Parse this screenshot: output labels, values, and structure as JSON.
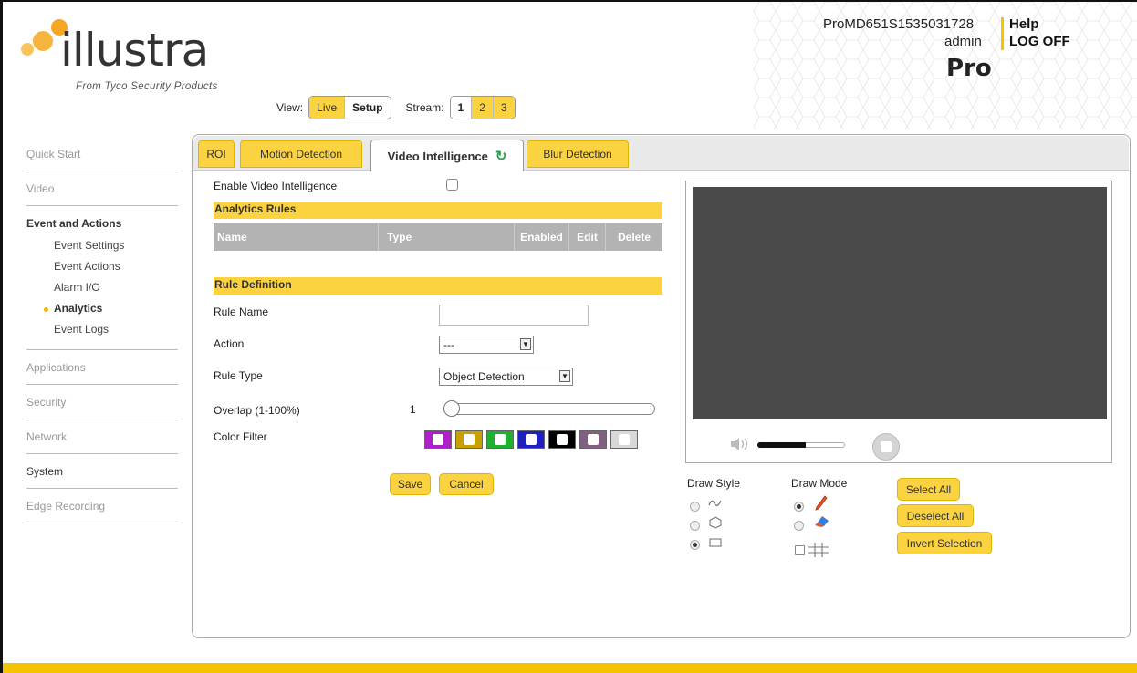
{
  "header": {
    "logo_text": "illustra",
    "logo_tagline": "From Tyco Security Products",
    "device_id": "ProMD651S1535031728",
    "user": "admin",
    "help": "Help",
    "logoff": "LOG OFF",
    "product": "Pro"
  },
  "view": {
    "label": "View:",
    "options": [
      "Live",
      "Setup"
    ],
    "selected": "Setup"
  },
  "stream": {
    "label": "Stream:",
    "options": [
      "1",
      "2",
      "3"
    ],
    "selected": "1"
  },
  "sidebar": {
    "quick_start": "Quick Start",
    "video": "Video",
    "event_group": "Event and Actions",
    "event_items": [
      "Event Settings",
      "Event Actions",
      "Alarm I/O",
      "Analytics",
      "Event Logs"
    ],
    "active_item": "Analytics",
    "applications": "Applications",
    "security": "Security",
    "network": "Network",
    "system": "System",
    "edge_recording": "Edge Recording"
  },
  "tabs": [
    "ROI",
    "Motion Detection",
    "Video Intelligence",
    "Blur Detection"
  ],
  "active_tab": "Video Intelligence",
  "form": {
    "enable_label": "Enable Video Intelligence",
    "enable_checked": false,
    "analytics_rules_title": "Analytics Rules",
    "rules_columns": [
      "Name",
      "Type",
      "Enabled",
      "Edit",
      "Delete"
    ],
    "rule_definition_title": "Rule Definition",
    "rule_name_label": "Rule Name",
    "rule_name_value": "",
    "action_label": "Action",
    "action_value": "---",
    "rule_type_label": "Rule Type",
    "rule_type_value": "Object Detection",
    "overlap_label": "Overlap (1-100%)",
    "overlap_value": "1",
    "color_filter_label": "Color Filter",
    "color_swatches": [
      "#b020c8",
      "#c8a000",
      "#20b030",
      "#2020c0",
      "#000000",
      "#806080",
      "#d8d8d8"
    ],
    "save": "Save",
    "cancel": "Cancel"
  },
  "draw": {
    "style_label": "Draw Style",
    "mode_label": "Draw Mode",
    "style_options": [
      "freehand-icon",
      "polygon-icon",
      "rectangle-icon"
    ],
    "style_selected": 2,
    "mode_options": [
      "pencil-icon",
      "eraser-icon"
    ],
    "mode_selected": 0,
    "select_all": "Select All",
    "deselect_all": "Deselect All",
    "invert_selection": "Invert Selection"
  },
  "player": {
    "volume_fraction": 0.55
  },
  "colors": {
    "accent": "#fbd23f",
    "video_bg": "#4a4a4a"
  }
}
